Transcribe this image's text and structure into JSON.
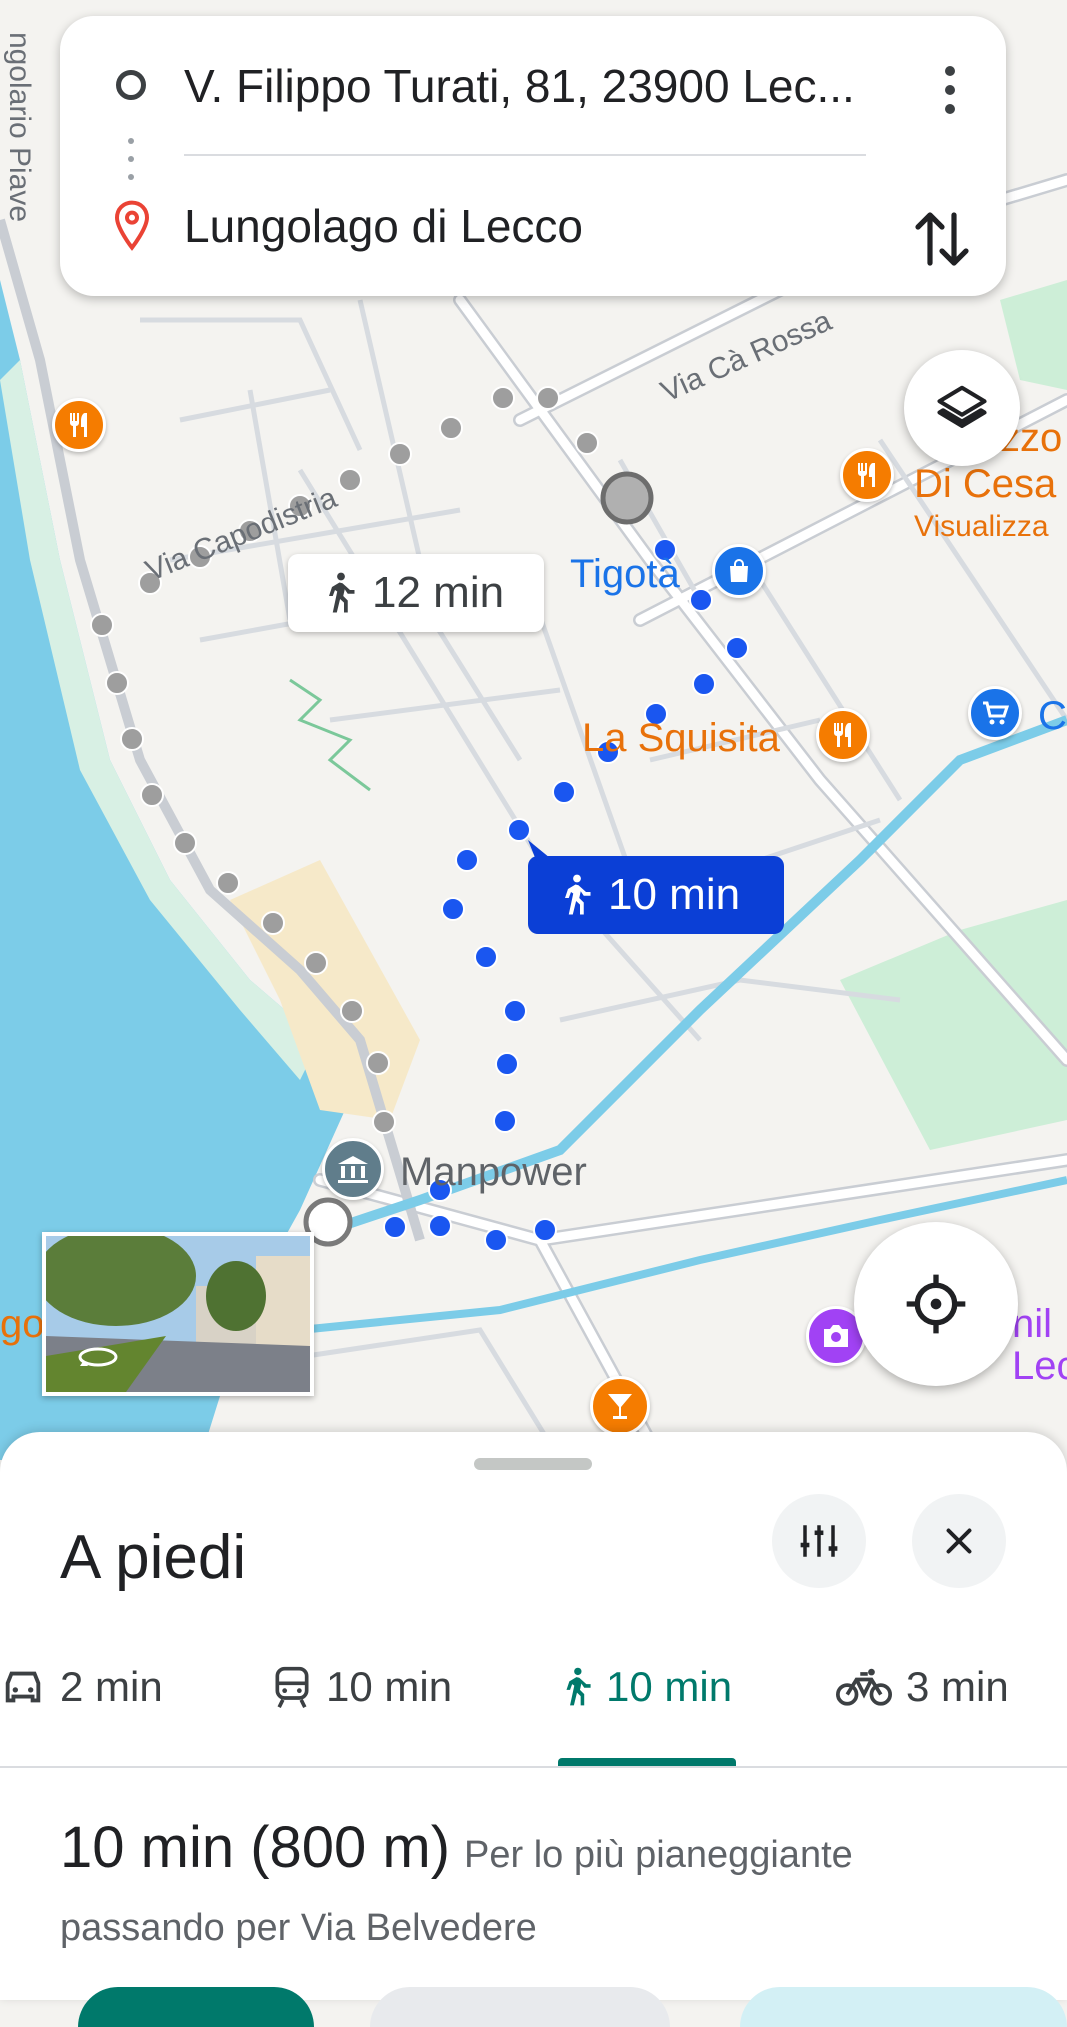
{
  "directions": {
    "origin": "V. Filippo Turati, 81, 23900 Lec...",
    "destination": "Lungolago di Lecco"
  },
  "map": {
    "streets": [
      "Via Cà Rossa",
      "Via Capodistria",
      "ngolario Piave"
    ],
    "places": [
      {
        "name": "Tigotà",
        "icon": "shopping-bag-icon"
      },
      {
        "name": "La Squisita",
        "icon": "restaurant-icon"
      },
      {
        "name": "Manpower",
        "icon": "building-icon"
      },
      {
        "name": "Di Cesa",
        "icon": "restaurant-icon"
      },
      {
        "name": "Visualizza",
        "icon": ""
      },
      {
        "name": "zzo",
        "icon": ""
      },
      {
        "name": "go",
        "icon": ""
      },
      {
        "name": "nil",
        "icon": "camera-icon"
      },
      {
        "name": "Lec",
        "icon": ""
      },
      {
        "name": "C",
        "icon": "cart-icon"
      }
    ],
    "route_alt_time": "12 min",
    "route_main_time": "10 min"
  },
  "sheet": {
    "title": "A piedi",
    "modes": [
      {
        "label": "2 min",
        "icon": "car-icon"
      },
      {
        "label": "10 min",
        "icon": "train-icon"
      },
      {
        "label": "10 min",
        "icon": "walk-icon"
      },
      {
        "label": "3 min",
        "icon": "bike-icon"
      }
    ],
    "selected_mode": 2,
    "summary_time": "10 min (800 m)",
    "summary_desc": "Per lo più pianeggiante",
    "summary_via": "passando per Via Belvedere"
  },
  "colors": {
    "route_blue": "#1a56f0",
    "route_grey": "#9e9e9e",
    "water": "#7ccce8",
    "accent_teal": "#00796b",
    "poi_orange": "#f57c00",
    "selected_badge": "#0b3fd6"
  }
}
